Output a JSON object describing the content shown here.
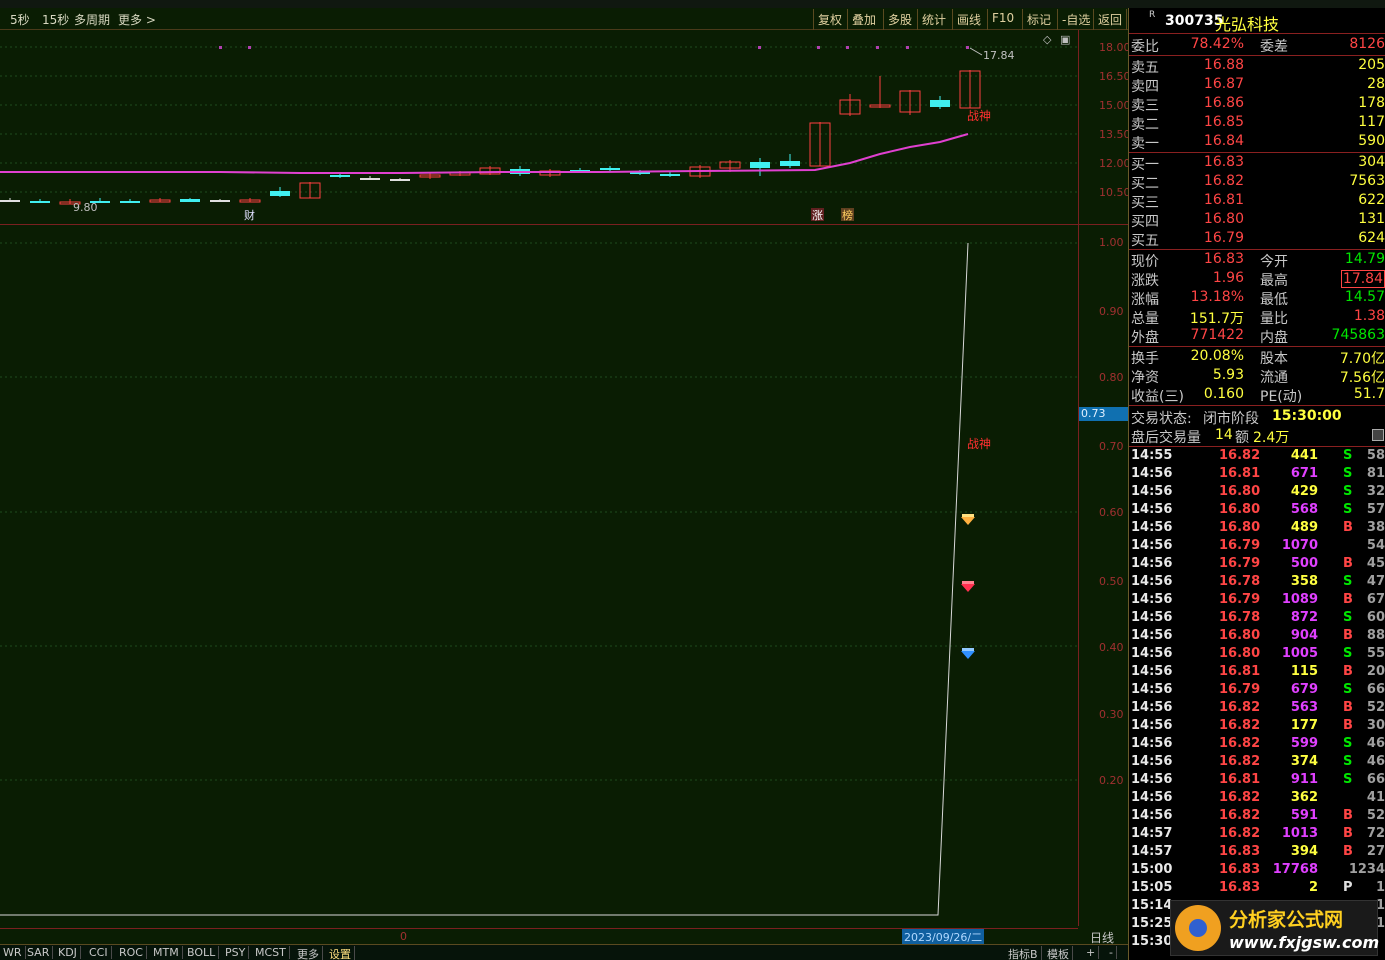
{
  "toolbar": {
    "periods": [
      "5秒",
      "15秒",
      "多周期",
      "更多 >"
    ],
    "buttons": [
      "复权",
      "叠加",
      "多股",
      "统计",
      "画线",
      "F10",
      "标记",
      "-自选",
      "返回"
    ]
  },
  "chart": {
    "price_axis": [
      "18.00",
      "16.50",
      "15.00",
      "13.50",
      "12.00",
      "10.50"
    ],
    "indicator_axis": [
      "1.00",
      "0.90",
      "0.80",
      "0.70",
      "0.60",
      "0.50",
      "0.40",
      "0.30",
      "0.20"
    ],
    "current_marker": "0.73",
    "high_label": "17.84",
    "low_label": "9.80",
    "signal_label_main": "战神",
    "signal_label_sub": "战神",
    "event_labels": [
      "财",
      "涨",
      "榜"
    ],
    "date_label": "2023/09/26/二",
    "period_label": "日线",
    "start_marker": "0"
  },
  "chart_data": {
    "type": "line",
    "title": "",
    "series": [
      {
        "name": "",
        "values": [
          0,
          0,
          0,
          0,
          0,
          0,
          0,
          0,
          0,
          0,
          0,
          0,
          0,
          0,
          0,
          0,
          0,
          0,
          0,
          0,
          0,
          0,
          0,
          0,
          0,
          0,
          0,
          0,
          0,
          0,
          0,
          1.0
        ]
      }
    ],
    "ylim": [
      0,
      1.0
    ]
  },
  "quote": {
    "code": "300735",
    "name": "光弘科技",
    "badge": "R",
    "weibi": {
      "label": "委比",
      "value": "78.42%",
      "label2": "委差",
      "value2": "8126"
    },
    "asks": [
      {
        "label": "卖五",
        "price": "16.88",
        "vol": "205"
      },
      {
        "label": "卖四",
        "price": "16.87",
        "vol": "28"
      },
      {
        "label": "卖三",
        "price": "16.86",
        "vol": "178"
      },
      {
        "label": "卖二",
        "price": "16.85",
        "vol": "117"
      },
      {
        "label": "卖一",
        "price": "16.84",
        "vol": "590"
      }
    ],
    "bids": [
      {
        "label": "买一",
        "price": "16.83",
        "vol": "304"
      },
      {
        "label": "买二",
        "price": "16.82",
        "vol": "7563"
      },
      {
        "label": "买三",
        "price": "16.81",
        "vol": "622"
      },
      {
        "label": "买四",
        "price": "16.80",
        "vol": "131"
      },
      {
        "label": "买五",
        "price": "16.79",
        "vol": "624"
      }
    ],
    "stats": [
      {
        "l1": "现价",
        "v1": "16.83",
        "l2": "今开",
        "v2": "14.79"
      },
      {
        "l1": "涨跌",
        "v1": "1.96",
        "l2": "最高",
        "v2": "17.84"
      },
      {
        "l1": "涨幅",
        "v1": "13.18%",
        "l2": "最低",
        "v2": "14.57"
      },
      {
        "l1": "总量",
        "v1": "151.7万",
        "l2": "量比",
        "v2": "1.38"
      },
      {
        "l1": "外盘",
        "v1": "771422",
        "l2": "内盘",
        "v2": "745863"
      }
    ],
    "stats2": [
      {
        "l1": "换手",
        "v1": "20.08%",
        "l2": "股本",
        "v2": "7.70亿"
      },
      {
        "l1": "净资",
        "v1": "5.93",
        "l2": "流通",
        "v2": "7.56亿"
      },
      {
        "l1": "收益(三)",
        "v1": "0.160",
        "l2": "PE(动)",
        "v2": "51.7"
      }
    ],
    "status": {
      "label": "交易状态:",
      "value": "闭市阶段",
      "time": "15:30:00"
    },
    "after": {
      "label": "盘后交易量",
      "vol": "14",
      "amt_label": "额",
      "amt": "2.4万"
    },
    "ticks": [
      {
        "t": "14:55",
        "p": "16.82",
        "v": "441",
        "f": "S",
        "n": "58"
      },
      {
        "t": "14:56",
        "p": "16.81",
        "v": "671",
        "f": "S",
        "n": "81"
      },
      {
        "t": "14:56",
        "p": "16.80",
        "v": "429",
        "f": "S",
        "n": "32"
      },
      {
        "t": "14:56",
        "p": "16.80",
        "v": "568",
        "f": "S",
        "n": "57"
      },
      {
        "t": "14:56",
        "p": "16.80",
        "v": "489",
        "f": "B",
        "n": "38"
      },
      {
        "t": "14:56",
        "p": "16.79",
        "v": "1070",
        "f": "",
        "n": "54"
      },
      {
        "t": "14:56",
        "p": "16.79",
        "v": "500",
        "f": "B",
        "n": "45"
      },
      {
        "t": "14:56",
        "p": "16.78",
        "v": "358",
        "f": "S",
        "n": "47"
      },
      {
        "t": "14:56",
        "p": "16.79",
        "v": "1089",
        "f": "B",
        "n": "67"
      },
      {
        "t": "14:56",
        "p": "16.78",
        "v": "872",
        "f": "S",
        "n": "60"
      },
      {
        "t": "14:56",
        "p": "16.80",
        "v": "904",
        "f": "B",
        "n": "88"
      },
      {
        "t": "14:56",
        "p": "16.80",
        "v": "1005",
        "f": "S",
        "n": "55"
      },
      {
        "t": "14:56",
        "p": "16.81",
        "v": "115",
        "f": "B",
        "n": "20"
      },
      {
        "t": "14:56",
        "p": "16.79",
        "v": "679",
        "f": "S",
        "n": "66"
      },
      {
        "t": "14:56",
        "p": "16.82",
        "v": "563",
        "f": "B",
        "n": "52"
      },
      {
        "t": "14:56",
        "p": "16.82",
        "v": "177",
        "f": "B",
        "n": "30"
      },
      {
        "t": "14:56",
        "p": "16.82",
        "v": "599",
        "f": "S",
        "n": "46"
      },
      {
        "t": "14:56",
        "p": "16.82",
        "v": "374",
        "f": "S",
        "n": "46"
      },
      {
        "t": "14:56",
        "p": "16.81",
        "v": "911",
        "f": "S",
        "n": "66"
      },
      {
        "t": "14:56",
        "p": "16.82",
        "v": "362",
        "f": "",
        "n": "41"
      },
      {
        "t": "14:56",
        "p": "16.82",
        "v": "591",
        "f": "B",
        "n": "52"
      },
      {
        "t": "14:57",
        "p": "16.82",
        "v": "1013",
        "f": "B",
        "n": "72"
      },
      {
        "t": "14:57",
        "p": "16.83",
        "v": "394",
        "f": "B",
        "n": "27"
      },
      {
        "t": "15:00",
        "p": "16.83",
        "v": "17768",
        "f": "",
        "n": "1234"
      },
      {
        "t": "15:05",
        "p": "16.83",
        "v": "2",
        "f": "P",
        "n": "1"
      },
      {
        "t": "15:14",
        "p": "",
        "v": "",
        "f": "",
        "n": "1"
      },
      {
        "t": "15:25",
        "p": "",
        "v": "",
        "f": "",
        "n": "1"
      },
      {
        "t": "15:30",
        "p": "",
        "v": "",
        "f": "",
        "n": ""
      }
    ]
  },
  "bottom_tabs": [
    "WR",
    "SAR",
    "KDJ",
    "CCI",
    "ROC",
    "MTM",
    "BOLL",
    "PSY",
    "MCST",
    "更多",
    "设置"
  ],
  "bottom_right": [
    "指标B",
    "模板",
    "+",
    "-"
  ],
  "watermark": {
    "title": "分析家公式网",
    "url": "www.fxjgsw.com"
  }
}
